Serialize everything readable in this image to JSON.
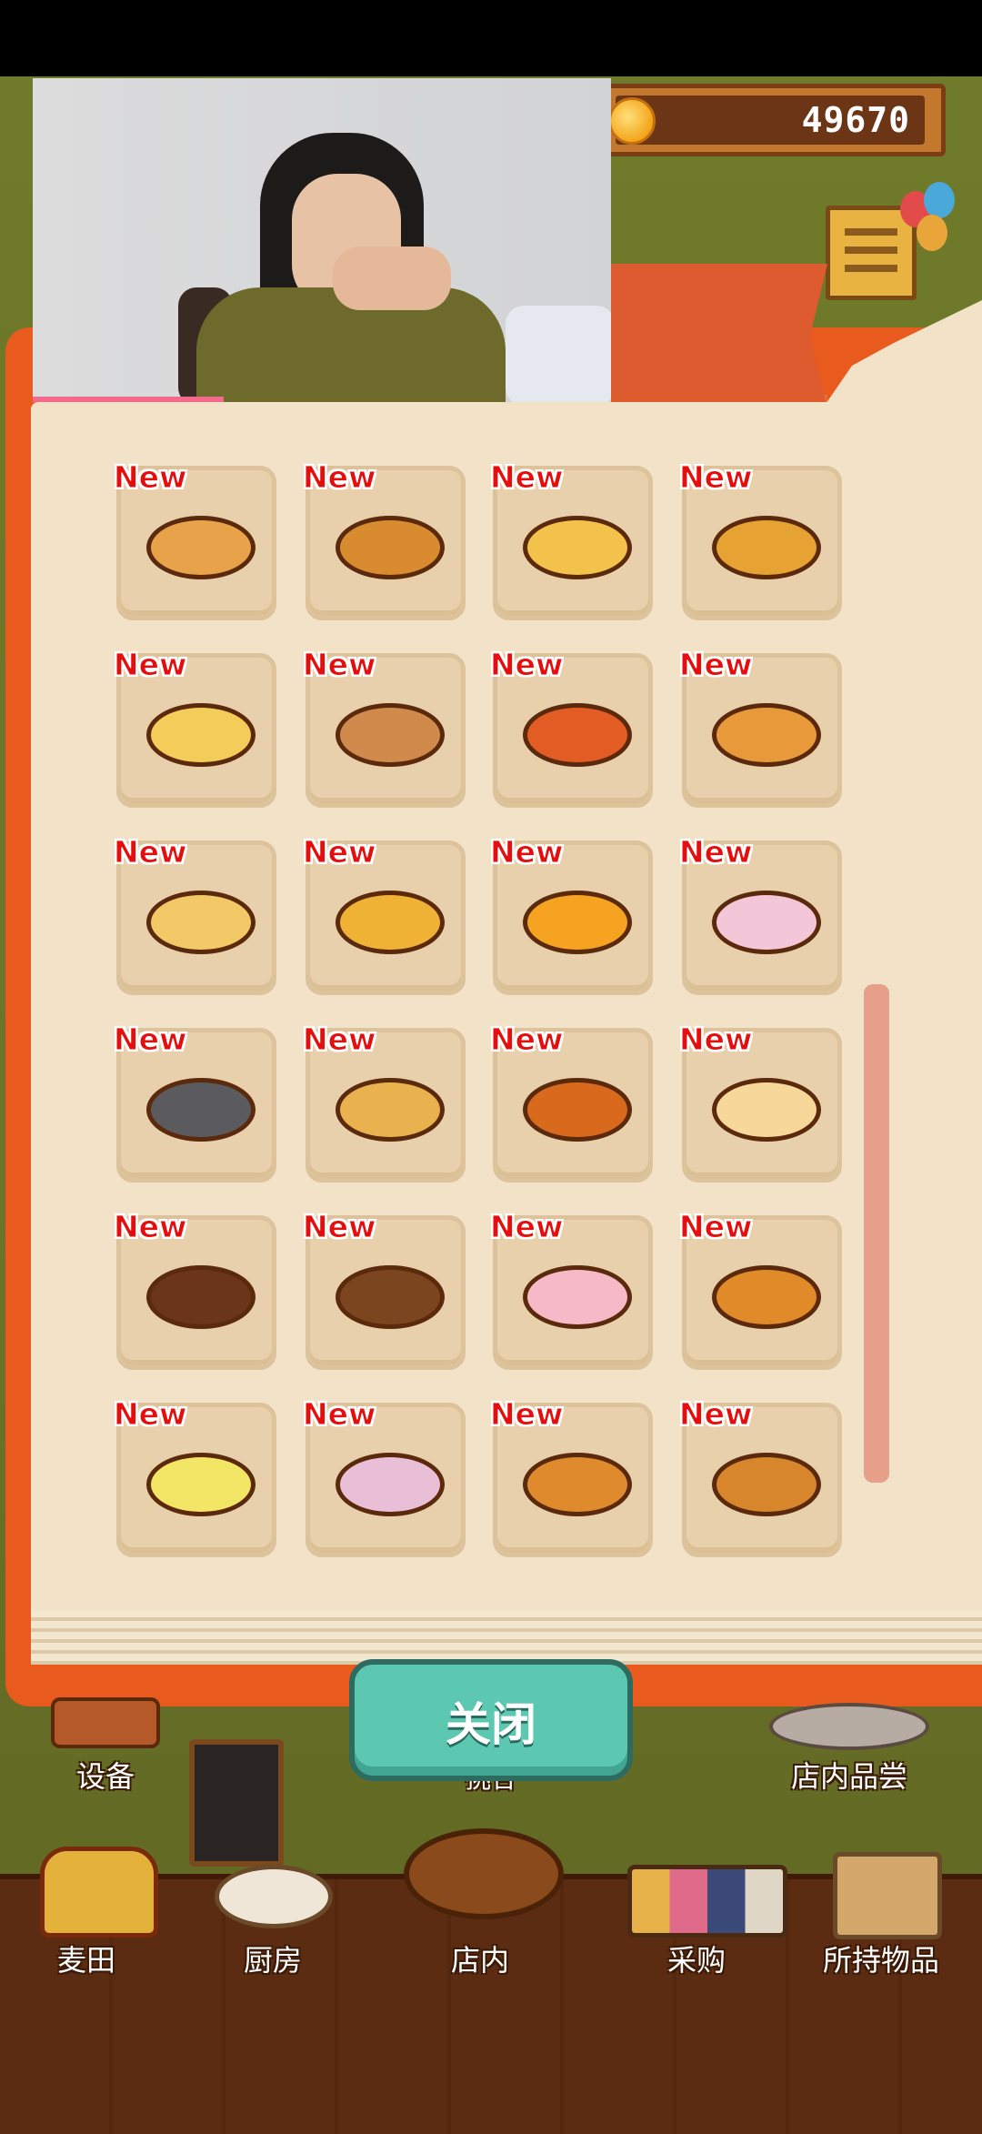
{
  "top_bar": {
    "coins": "49670"
  },
  "items": [
    {
      "badge": "New",
      "color": "#e8a24a"
    },
    {
      "badge": "New",
      "color": "#d98c2f"
    },
    {
      "badge": "New",
      "color": "#f3c24a"
    },
    {
      "badge": "New",
      "color": "#e6a232"
    },
    {
      "badge": "New",
      "color": "#f4cc5a"
    },
    {
      "badge": "New",
      "color": "#d08b4c"
    },
    {
      "badge": "New",
      "color": "#e35c23"
    },
    {
      "badge": "New",
      "color": "#e89a3a"
    },
    {
      "badge": "New",
      "color": "#f3c867"
    },
    {
      "badge": "New",
      "color": "#f0b235"
    },
    {
      "badge": "New",
      "color": "#f5a320"
    },
    {
      "badge": "New",
      "color": "#f3c6d8"
    },
    {
      "badge": "New",
      "color": "#5b5a5e"
    },
    {
      "badge": "New",
      "color": "#e9b24e"
    },
    {
      "badge": "New",
      "color": "#d8691d"
    },
    {
      "badge": "New",
      "color": "#f7d79a"
    },
    {
      "badge": "New",
      "color": "#6a3519"
    },
    {
      "badge": "New",
      "color": "#7b4520"
    },
    {
      "badge": "New",
      "color": "#f6b9c8"
    },
    {
      "badge": "New",
      "color": "#e08a2a"
    },
    {
      "badge": "New",
      "color": "#f3e565"
    },
    {
      "badge": "New",
      "color": "#e9bed7"
    },
    {
      "badge": "New",
      "color": "#e08a2e"
    },
    {
      "badge": "New",
      "color": "#d8862c"
    }
  ],
  "close_button": {
    "label": "关闭"
  },
  "scene_labels": {
    "equipment": "设备",
    "tasting": "店内品尝",
    "partial": "挑合"
  },
  "bottom_nav": [
    {
      "label": "麦田"
    },
    {
      "label": "厨房"
    },
    {
      "label": "店内"
    },
    {
      "label": "采购"
    },
    {
      "label": "所持物品"
    }
  ]
}
